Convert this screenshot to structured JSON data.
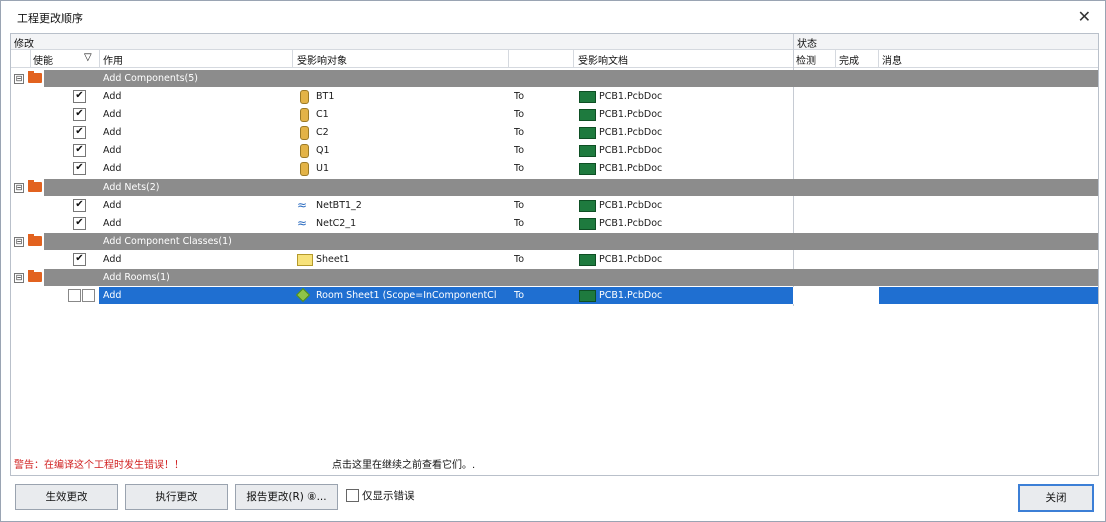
{
  "window": {
    "title": "工程更改顺序",
    "close_glyph": "✕"
  },
  "table": {
    "group_headers": {
      "modify": "修改",
      "status": "状态"
    },
    "columns": {
      "enable": "使能",
      "filter_glyph": "▽",
      "action": "作用",
      "affected_object": "受影响对象",
      "affected_doc": "受影响文档",
      "check": "检测",
      "done": "完成",
      "message": "消息"
    },
    "groups": [
      {
        "label": "Add Components(5)",
        "expander": "⊟",
        "rows": [
          {
            "checked": "✔",
            "action": "Add",
            "object": "BT1",
            "to": "To",
            "doc": "PCB1.PcbDoc",
            "icon": "component-icon"
          },
          {
            "checked": "✔",
            "action": "Add",
            "object": "C1",
            "to": "To",
            "doc": "PCB1.PcbDoc",
            "icon": "component-icon"
          },
          {
            "checked": "✔",
            "action": "Add",
            "object": "C2",
            "to": "To",
            "doc": "PCB1.PcbDoc",
            "icon": "component-icon"
          },
          {
            "checked": "✔",
            "action": "Add",
            "object": "Q1",
            "to": "To",
            "doc": "PCB1.PcbDoc",
            "icon": "component-icon"
          },
          {
            "checked": "✔",
            "action": "Add",
            "object": "U1",
            "to": "To",
            "doc": "PCB1.PcbDoc",
            "icon": "component-icon"
          }
        ]
      },
      {
        "label": "Add Nets(2)",
        "expander": "⊟",
        "rows": [
          {
            "checked": "✔",
            "action": "Add",
            "object": "NetBT1_2",
            "to": "To",
            "doc": "PCB1.PcbDoc",
            "icon": "net-icon"
          },
          {
            "checked": "✔",
            "action": "Add",
            "object": "NetC2_1",
            "to": "To",
            "doc": "PCB1.PcbDoc",
            "icon": "net-icon"
          }
        ]
      },
      {
        "label": "Add Component Classes(1)",
        "expander": "⊟",
        "rows": [
          {
            "checked": "✔",
            "action": "Add",
            "object": "Sheet1",
            "to": "To",
            "doc": "PCB1.PcbDoc",
            "icon": "class-icon"
          }
        ]
      },
      {
        "label": "Add Rooms(1)",
        "expander": "⊟",
        "rows": [
          {
            "checked": "",
            "action": "Add",
            "object": "Room Sheet1 (Scope=InComponentCl",
            "to": "To",
            "doc": "PCB1.PcbDoc",
            "icon": "room-icon",
            "selected": true
          }
        ]
      }
    ],
    "net_glyph": "≈"
  },
  "messages": {
    "warning": "警告：在编译这个工程时发生错误！！",
    "hint": "点击这里在继续之前查看它们。."
  },
  "buttons": {
    "validate": "生效更改",
    "execute": "执行更改",
    "report": "报告更改(R) ⑧...",
    "only_errors": "仅显示错误",
    "close": "关闭"
  },
  "colors": {
    "group_band": "#8c8c8c",
    "selection": "#1f6fd1",
    "warning_text": "#d02020",
    "folder": "#e2621f",
    "pcb_doc_icon": "#1e7a3e"
  }
}
